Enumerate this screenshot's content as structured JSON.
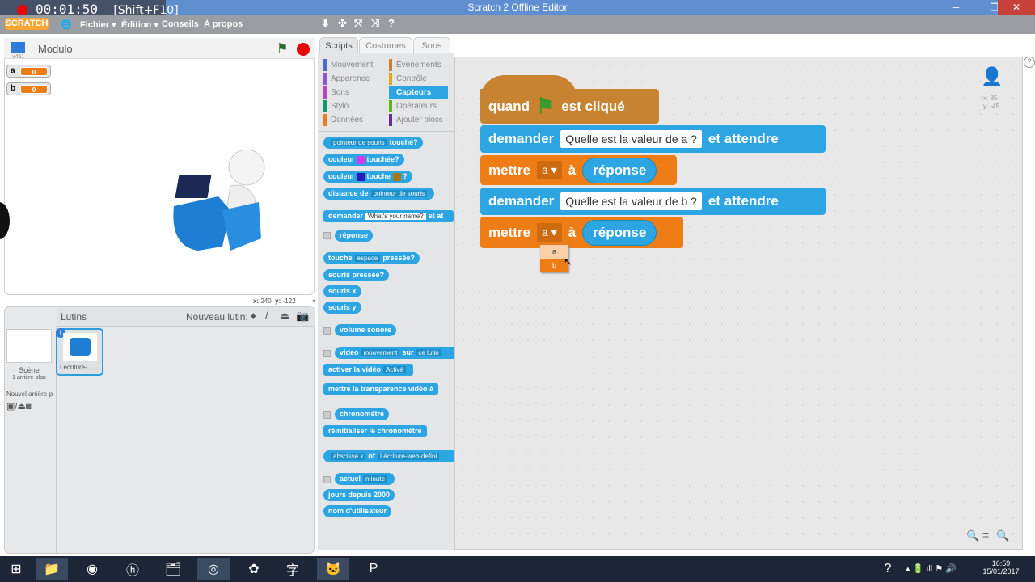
{
  "window": {
    "title": "Scratch 2 Offline Editor",
    "recorder_time": "00:01:50",
    "recorder_shortcut": "[Shift+F10]"
  },
  "menu": {
    "logo": "SCRATCH",
    "items": [
      "Fichier ▾",
      "Édition ▾",
      "Conseils",
      "À propos"
    ]
  },
  "stage": {
    "project_name": "Modulo",
    "version": "v451",
    "variables": [
      {
        "name": "a",
        "value": "0"
      },
      {
        "name": "b",
        "value": "0"
      }
    ],
    "mouse_x_label": "x:",
    "mouse_x": "240",
    "mouse_y_label": "y:",
    "mouse_y": "-122"
  },
  "sprites": {
    "title": "Lutins",
    "new_sprite_label": "Nouveau lutin:",
    "scene_label": "Scène",
    "scene_backdrops": "1 arrière-plan",
    "new_backdrop_label": "Nouvel arrière-p",
    "sprite_name": "Lécriture-..."
  },
  "tabs": [
    "Scripts",
    "Costumes",
    "Sons"
  ],
  "categories": {
    "left": [
      {
        "label": "Mouvement",
        "color": "#4a6cd4"
      },
      {
        "label": "Apparence",
        "color": "#8a55d7"
      },
      {
        "label": "Sons",
        "color": "#bb42c3"
      },
      {
        "label": "Stylo",
        "color": "#0e9a6c"
      },
      {
        "label": "Données",
        "color": "#ee7d16"
      }
    ],
    "right": [
      {
        "label": "Événements",
        "color": "#c88330"
      },
      {
        "label": "Contrôle",
        "color": "#e1a91a"
      },
      {
        "label": "Capteurs",
        "color": "#2ca5e2"
      },
      {
        "label": "Opérateurs",
        "color": "#5cb712"
      },
      {
        "label": "Ajouter blocs",
        "color": "#632d99"
      }
    ],
    "selected": "Capteurs"
  },
  "palette": {
    "touching": {
      "dd": "pointeur de souris",
      "t": "touché?"
    },
    "color_touching": {
      "a": "couleur",
      "b": "touchée?"
    },
    "color_color": {
      "a": "couleur",
      "b": "touche",
      "c": "?"
    },
    "distance": {
      "a": "distance de",
      "dd": "pointeur de souris"
    },
    "ask": {
      "a": "demander",
      "in": "What's your name?",
      "b": "et at"
    },
    "answer": "réponse",
    "key": {
      "a": "touche",
      "dd": "espace",
      "b": "pressée?"
    },
    "mouse_down": "souris pressée?",
    "mouse_x": "souris x",
    "mouse_y": "souris y",
    "loudness": "volume sonore",
    "video": {
      "a": "video",
      "dd": "mouvement",
      "b": "sur",
      "dd2": "ce lutin"
    },
    "video_on": {
      "a": "activer la vidéo",
      "dd": "Activé"
    },
    "video_transp": "mettre la transparence vidéo à",
    "timer": "chronomètre",
    "reset_timer": "réinitialiser le chronomètre",
    "of": {
      "dd": "abscisse x",
      "a": "of",
      "dd2": "Lécriture-web-defini"
    },
    "current": {
      "a": "actuel",
      "dd": "minute"
    },
    "days": "jours depuis 2000",
    "username": "nom d'utilisateur"
  },
  "script": {
    "hat": {
      "a": "quand",
      "b": "est cliqué"
    },
    "ask1": {
      "a": "demander",
      "in": "Quelle est la valeur de a ?",
      "b": "et attendre"
    },
    "set1": {
      "a": "mettre",
      "var": "a",
      "b": "à",
      "rep": "réponse"
    },
    "ask2": {
      "a": "demander",
      "in": "Quelle est la valeur de b ?",
      "b": "et attendre"
    },
    "set2": {
      "a": "mettre",
      "var": "a",
      "b": "à",
      "rep": "réponse"
    },
    "dropdown_options": [
      "a",
      "b"
    ],
    "sprite_x": "x: 85",
    "sprite_y": "y: -45"
  },
  "taskbar": {
    "time": "16:59",
    "date": "15/01/2017"
  }
}
